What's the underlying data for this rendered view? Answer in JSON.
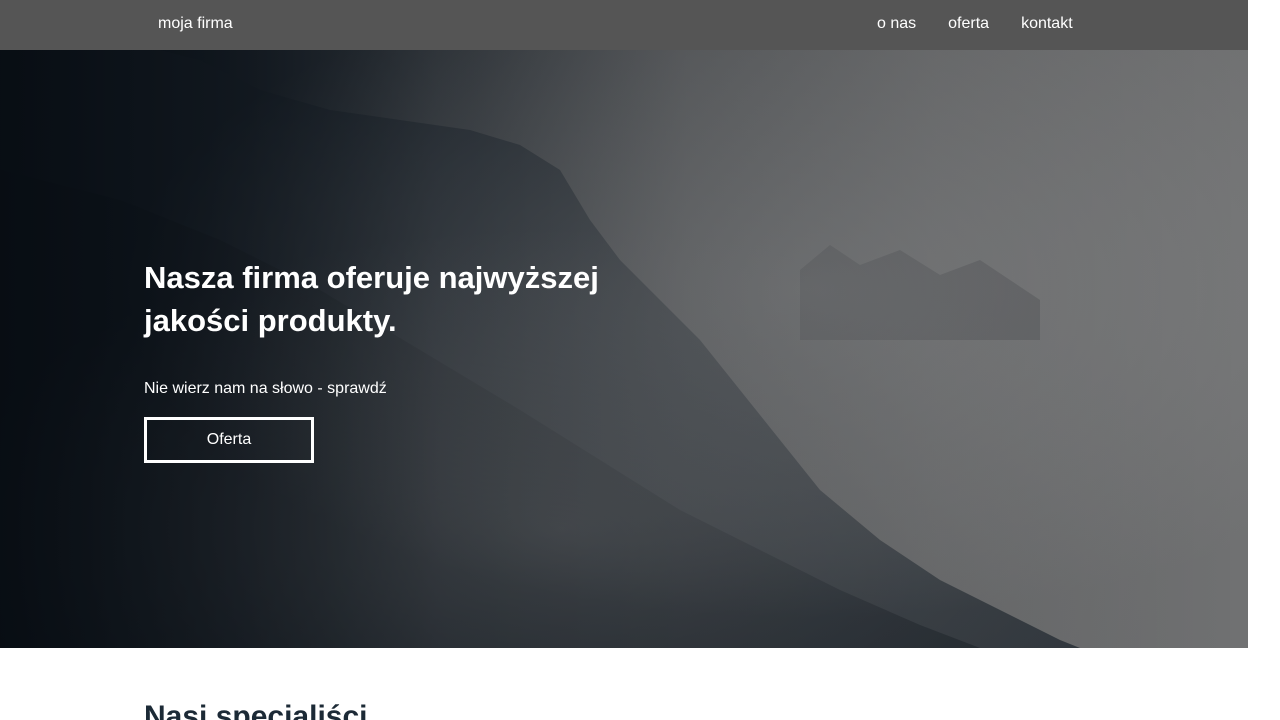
{
  "navbar": {
    "brand": "moja firma",
    "links": [
      "o nas",
      "oferta",
      "kontakt"
    ]
  },
  "hero": {
    "title": "Nasza firma oferuje najwyższej jakości produkty.",
    "subtitle": "Nie wierz nam na słowo - sprawdź",
    "button_label": "Oferta"
  },
  "section": {
    "title": "Nasi specjaliści"
  },
  "colors": {
    "navbar_bg": "#555555",
    "hero_dark": "#0d141c",
    "hero_fog": "#707172",
    "text_on_hero": "#ffffff",
    "section_title": "#1c2a36"
  }
}
